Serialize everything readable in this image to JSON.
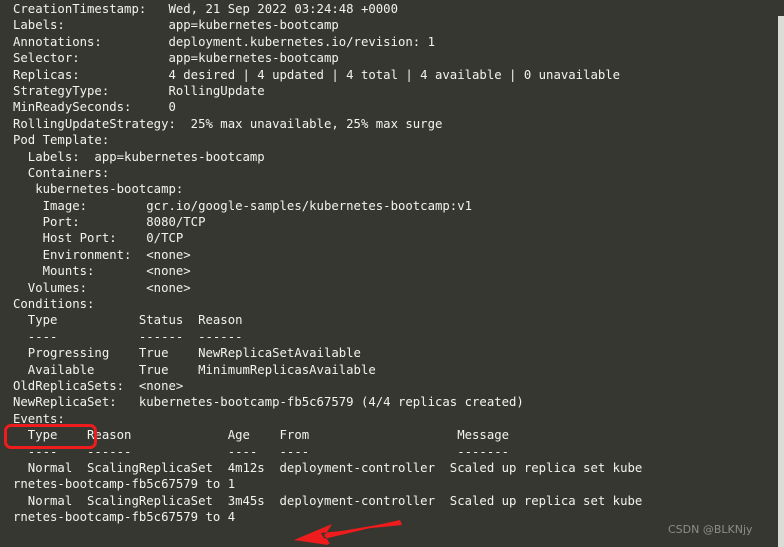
{
  "terminal": {
    "background_color": "#373731",
    "text_color": "#f2f2f0",
    "annotation_color": "#ee1c1c",
    "lines": [
      "CreationTimestamp:   Wed, 21 Sep 2022 03:24:48 +0000",
      "Labels:              app=kubernetes-bootcamp",
      "Annotations:         deployment.kubernetes.io/revision: 1",
      "Selector:            app=kubernetes-bootcamp",
      "Replicas:            4 desired | 4 updated | 4 total | 4 available | 0 unavailable",
      "StrategyType:        RollingUpdate",
      "MinReadySeconds:     0",
      "RollingUpdateStrategy:  25% max unavailable, 25% max surge",
      "Pod Template:",
      "  Labels:  app=kubernetes-bootcamp",
      "  Containers:",
      "   kubernetes-bootcamp:",
      "    Image:        gcr.io/google-samples/kubernetes-bootcamp:v1",
      "    Port:         8080/TCP",
      "    Host Port:    0/TCP",
      "    Environment:  <none>",
      "    Mounts:       <none>",
      "  Volumes:        <none>",
      "Conditions:",
      "  Type           Status  Reason",
      "  ----           ------  ------",
      "  Progressing    True    NewReplicaSetAvailable",
      "  Available      True    MinimumReplicasAvailable",
      "OldReplicaSets:  <none>",
      "NewReplicaSet:   kubernetes-bootcamp-fb5c67579 (4/4 replicas created)",
      "Events:",
      "  Type    Reason             Age    From                    Message",
      "  ----    ------             ----   ----                    -------",
      "  Normal  ScalingReplicaSet  4m12s  deployment-controller  Scaled up replica set kube",
      "rnetes-bootcamp-fb5c67579 to 1",
      "  Normal  ScalingReplicaSet  3m45s  deployment-controller  Scaled up replica set kube",
      "rnetes-bootcamp-fb5c67579 to 4"
    ]
  },
  "deployment": {
    "creation_timestamp": "Wed, 21 Sep 2022 03:24:48 +0000",
    "labels": "app=kubernetes-bootcamp",
    "annotations": "deployment.kubernetes.io/revision: 1",
    "selector": "app=kubernetes-bootcamp",
    "replicas": "4 desired | 4 updated | 4 total | 4 available | 0 unavailable",
    "strategy_type": "RollingUpdate",
    "min_ready_seconds": "0",
    "rolling_update_strategy": "25% max unavailable, 25% max surge",
    "pod_template": {
      "labels": "app=kubernetes-bootcamp",
      "container_name": "kubernetes-bootcamp",
      "image": "gcr.io/google-samples/kubernetes-bootcamp:v1",
      "port": "8080/TCP",
      "host_port": "0/TCP",
      "environment": "<none>",
      "mounts": "<none>",
      "volumes": "<none>"
    },
    "conditions": {
      "headers": [
        "Type",
        "Status",
        "Reason"
      ],
      "rows": [
        [
          "Progressing",
          "True",
          "NewReplicaSetAvailable"
        ],
        [
          "Available",
          "True",
          "MinimumReplicasAvailable"
        ]
      ]
    },
    "old_replica_sets": "<none>",
    "new_replica_set": "kubernetes-bootcamp-fb5c67579 (4/4 replicas created)",
    "events": {
      "label": "Events:",
      "headers": [
        "Type",
        "Reason",
        "Age",
        "From",
        "Message"
      ],
      "rows": [
        {
          "type": "Normal",
          "reason": "ScalingReplicaSet",
          "age": "4m12s",
          "from": "deployment-controller",
          "message": "Scaled up replica set kubernetes-bootcamp-fb5c67579 to 1"
        },
        {
          "type": "Normal",
          "reason": "ScalingReplicaSet",
          "age": "3m45s",
          "from": "deployment-controller",
          "message": "Scaled up replica set kubernetes-bootcamp-fb5c67579 to 4"
        }
      ]
    }
  },
  "annotations": {
    "events_highlight_target": "Events:",
    "arrow_target": "4"
  },
  "watermark": {
    "text": "CSDN @BLKNjy"
  }
}
